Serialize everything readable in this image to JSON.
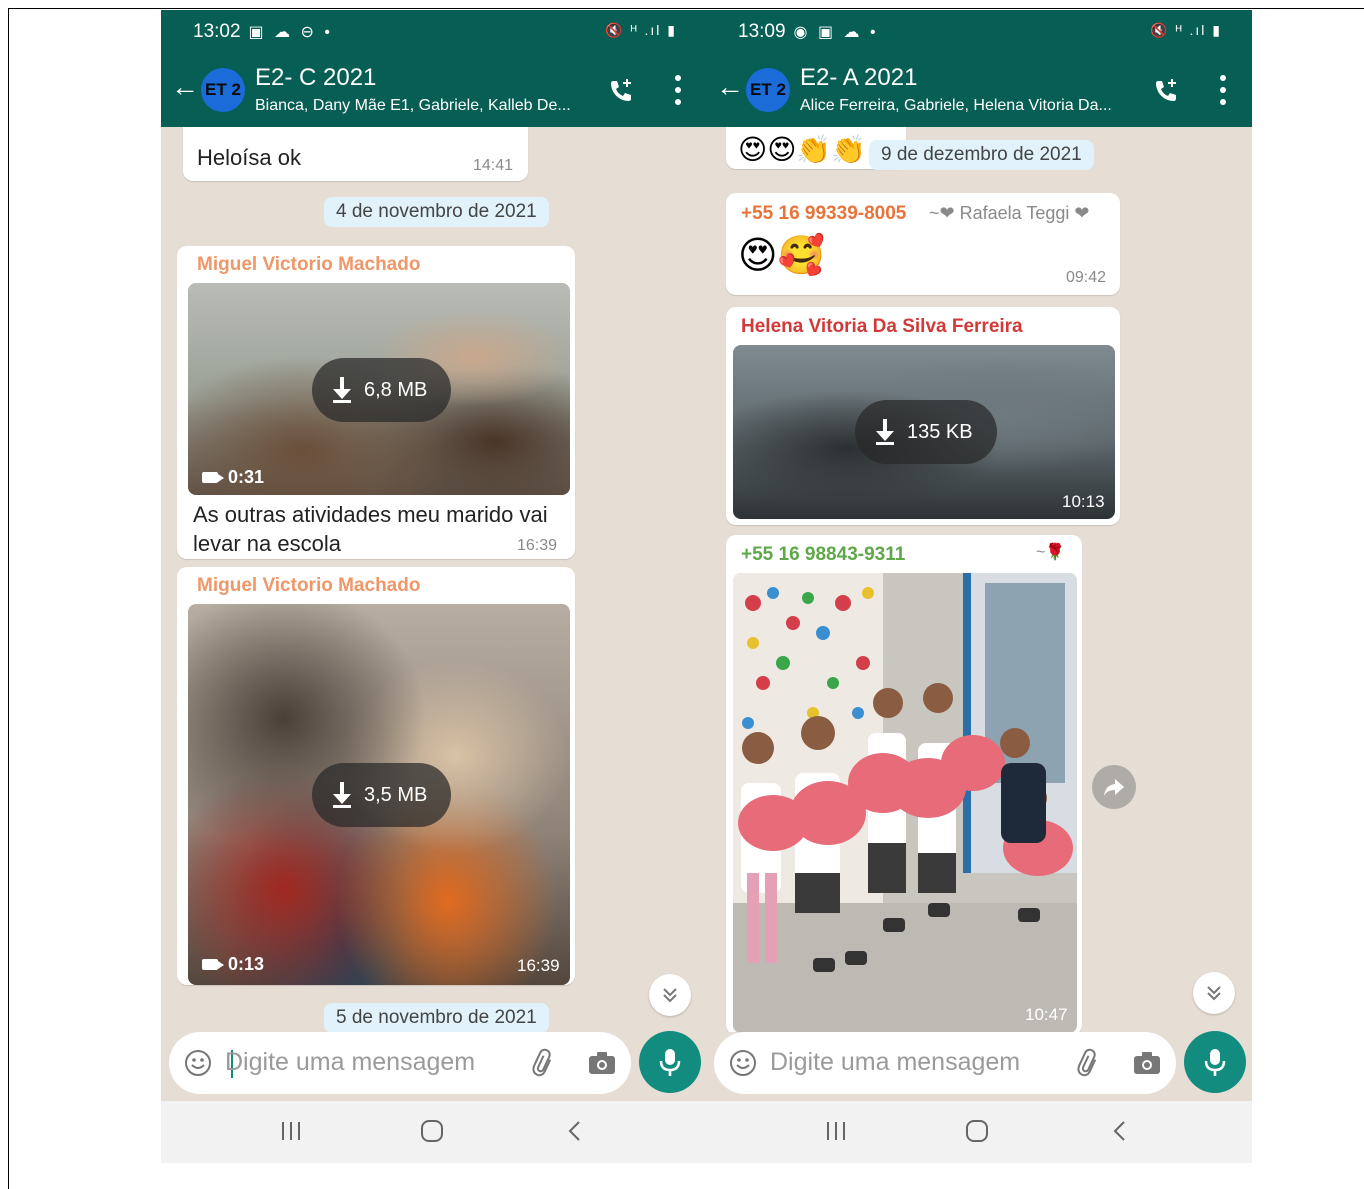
{
  "left": {
    "status": {
      "time": "13:02",
      "icons": "▣ ☁ ⊖ •",
      "right_icons": "🔇 ᴴ .ıl ▮"
    },
    "header": {
      "title": "E2- C 2021",
      "subtitle": "Bianca, Dany Mãe E1, Gabriele, Kalleb De...",
      "avatar": "ET 2"
    },
    "messages": {
      "m1": {
        "text": "Heloísa ok",
        "time": "14:41"
      },
      "date1": "4 de novembro de 2021",
      "m2": {
        "sender": "Miguel Victorio Machado",
        "size": "6,8 MB",
        "duration": "0:31",
        "caption_line1": "As outras atividades meu marido vai",
        "caption_line2": "levar na escola",
        "time": "16:39"
      },
      "m3": {
        "sender": "Miguel Victorio Machado",
        "size": "3,5 MB",
        "duration": "0:13",
        "time": "16:39"
      },
      "date2": "5 de novembro de 2021"
    },
    "input": {
      "placeholder": "Digite uma mensagem"
    }
  },
  "right": {
    "status": {
      "time": "13:09",
      "icons": "◉ ▣ ☁ •",
      "right_icons": "🔇 ᴴ .ıl ▮"
    },
    "header": {
      "title": "E2- A 2021",
      "subtitle": "Alice Ferreira, Gabriele, Helena Vitoria Da...",
      "avatar": "ET 2"
    },
    "messages": {
      "m0": {
        "emojis": "😍😍👏👏"
      },
      "date1": "9 de dezembro de 2021",
      "m1": {
        "sender": "+55 16 99339-8005",
        "push_name": "~❤ Rafaela Teggi ❤",
        "emojis": "😍🥰",
        "time": "09:42"
      },
      "m2": {
        "sender": "Helena Vitoria Da Silva Ferreira",
        "size": "135 KB",
        "time": "10:13"
      },
      "m3": {
        "sender": "+55 16 98843-9311",
        "push_name": "~🌹",
        "time": "10:47"
      }
    },
    "input": {
      "placeholder": "Digite uma mensagem"
    }
  },
  "colors": {
    "header": "#075e54",
    "accent": "#128c7e",
    "sender_orange": "#f0976a",
    "sender_red": "#d13a3a",
    "sender_green": "#5fa84a",
    "sender_orange2": "#e8743b"
  }
}
